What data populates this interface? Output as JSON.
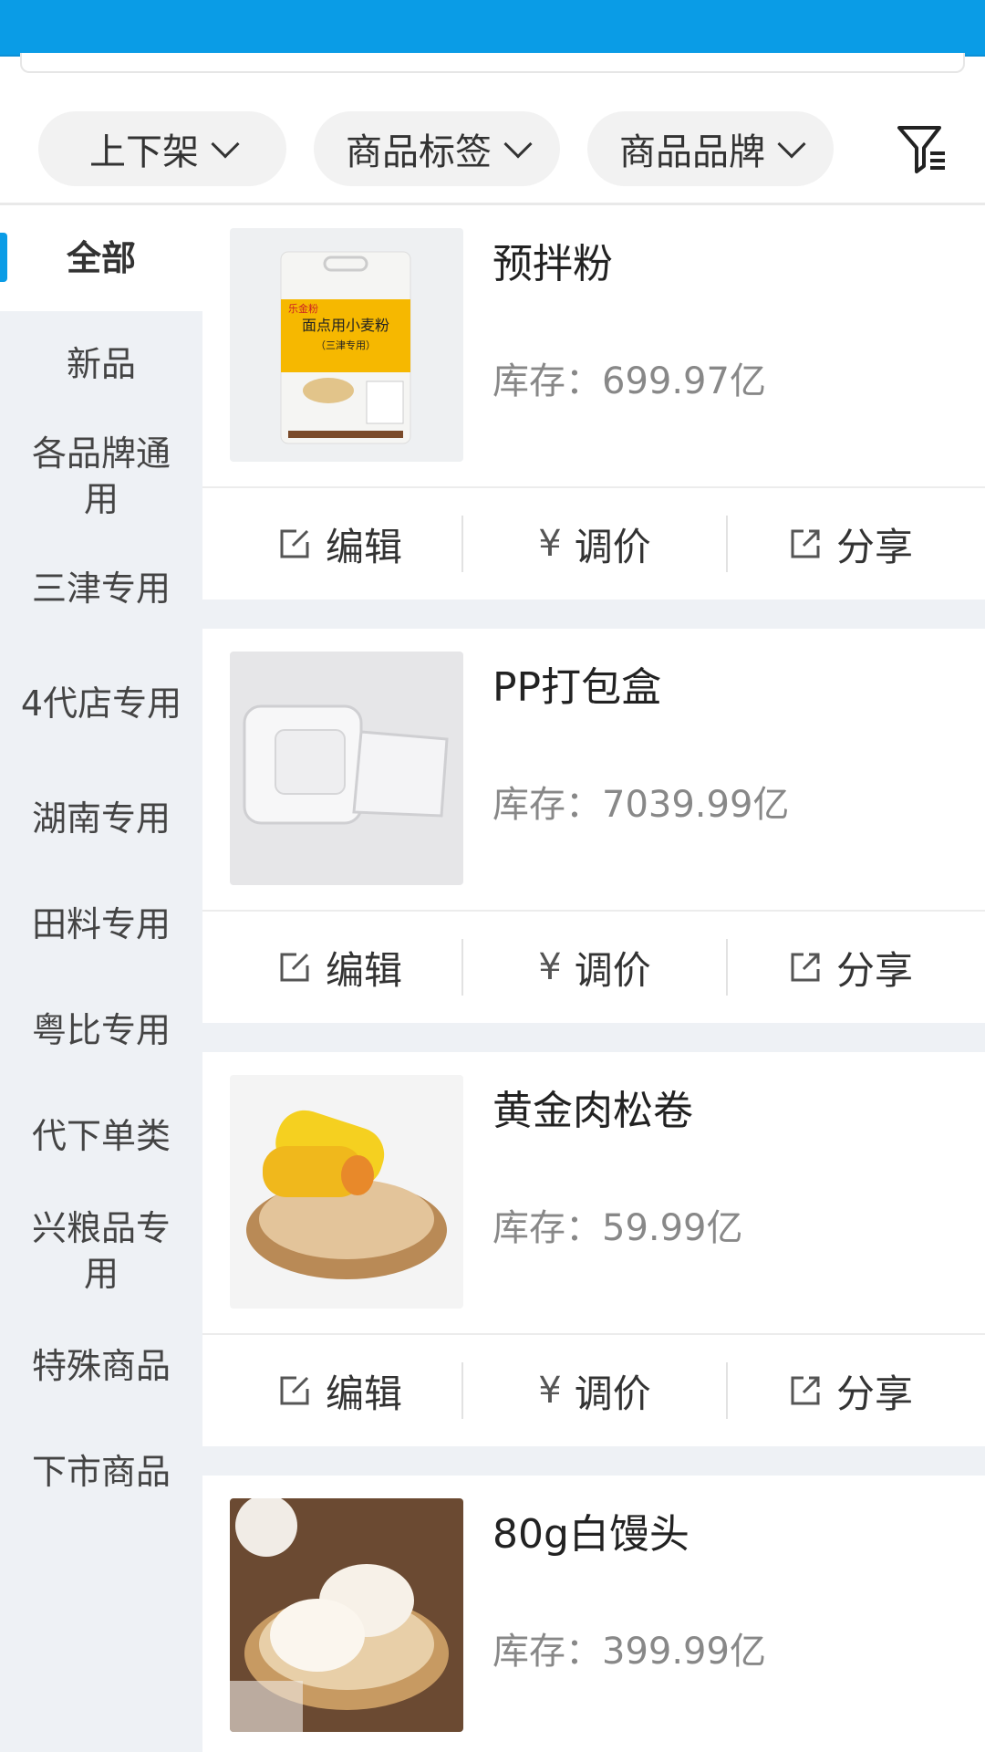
{
  "filters": [
    {
      "label": "上下架"
    },
    {
      "label": "商品标签"
    },
    {
      "label": "商品品牌"
    }
  ],
  "sidebar": {
    "items": [
      {
        "label": "全部",
        "active": true
      },
      {
        "label": "新品"
      },
      {
        "label": "各品牌通用"
      },
      {
        "label": "三津专用"
      },
      {
        "label": "4代店专用"
      },
      {
        "label": "湖南专用"
      },
      {
        "label": "田料专用"
      },
      {
        "label": "粤比专用"
      },
      {
        "label": "代下单类"
      },
      {
        "label": "兴粮品专用"
      },
      {
        "label": "特殊商品"
      },
      {
        "label": "下市商品"
      }
    ]
  },
  "actions": {
    "edit": "编辑",
    "price_symbol": "¥",
    "price": "调价",
    "share": "分享"
  },
  "products": [
    {
      "name": "预拌粉",
      "stock": "库存：699.97亿",
      "image": "flour-bag",
      "bag_brand": "乐金粉",
      "bag_title": "面点用小麦粉",
      "bag_sub": "（三津专用）"
    },
    {
      "name": "PP打包盒",
      "stock": "库存：7039.99亿",
      "image": "plastic-box"
    },
    {
      "name": "黄金肉松卷",
      "stock": "库存：59.99亿",
      "image": "pork-floss-roll"
    },
    {
      "name": "80g白馒头",
      "stock": "库存：399.99亿",
      "image": "steamed-buns"
    }
  ],
  "colors": {
    "accent": "#0a9ce6",
    "sidebar_bg": "#eef1f5"
  }
}
